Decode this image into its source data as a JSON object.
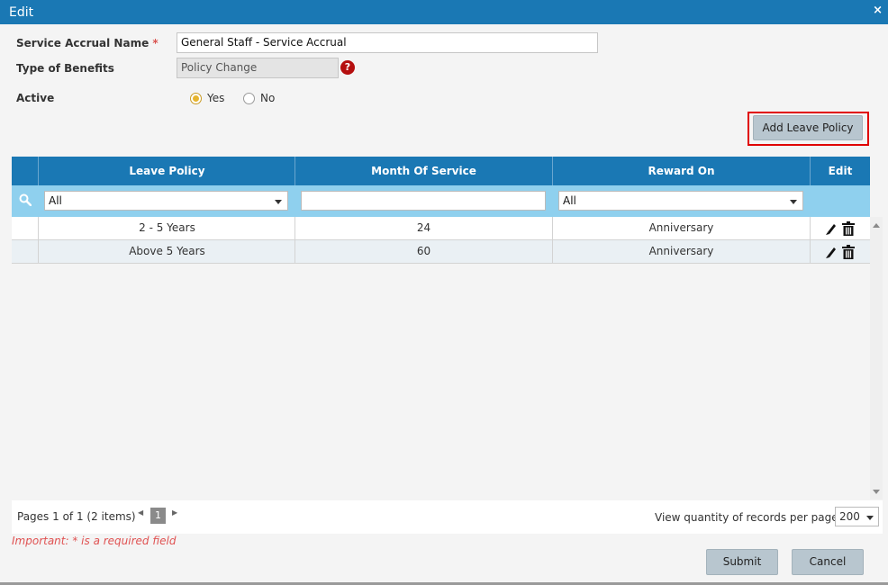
{
  "window": {
    "title": "Edit",
    "close_glyph": "×"
  },
  "form": {
    "service_accrual_name": {
      "label": "Service Accrual Name",
      "required_mark": "*",
      "value": "General Staff - Service Accrual"
    },
    "type_of_benefits": {
      "label": "Type of Benefits",
      "value": "Policy Change",
      "help_glyph": "?"
    },
    "active": {
      "label": "Active",
      "options": [
        {
          "label": "Yes",
          "checked": true
        },
        {
          "label": "No",
          "checked": false
        }
      ]
    }
  },
  "toolbar": {
    "add_leave_policy_label": "Add Leave Policy"
  },
  "grid": {
    "columns": [
      "Leave Policy",
      "Month Of Service",
      "Reward On",
      "Edit"
    ],
    "filters": {
      "leave_policy": "All",
      "month_of_service": "",
      "reward_on": "All"
    },
    "rows": [
      {
        "leave_policy": "2 - 5 Years",
        "month_of_service": "24",
        "reward_on": "Anniversary"
      },
      {
        "leave_policy": "Above 5 Years",
        "month_of_service": "60",
        "reward_on": "Anniversary"
      }
    ]
  },
  "pager": {
    "info": "Pages 1 of 1 (2 items)",
    "current_page": "1",
    "qty_label": "View quantity of records per page",
    "qty_value": "200"
  },
  "footer": {
    "important_note": "Important: * is a required field",
    "submit_label": "Submit",
    "cancel_label": "Cancel"
  },
  "colors": {
    "header_blue": "#1a78b4",
    "filter_blue": "#8fd0ee",
    "required_red": "#e05252",
    "highlight_red": "#e00000"
  }
}
